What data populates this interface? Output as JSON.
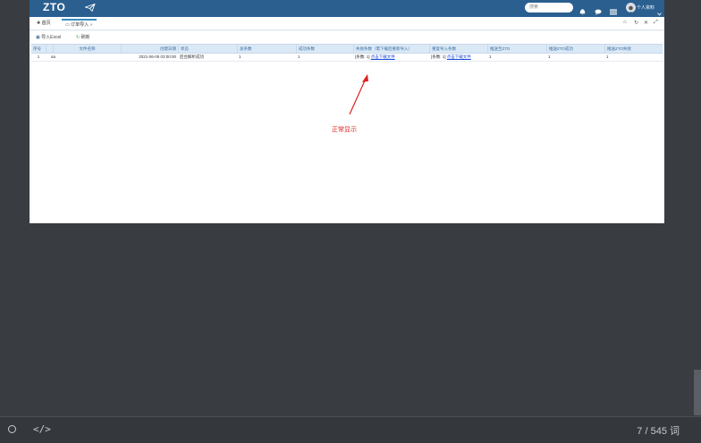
{
  "app": {
    "logo": "ZTO",
    "search_placeholder": "搜索",
    "user_label": "个人资料"
  },
  "tabs": [
    {
      "label": "首页"
    },
    {
      "label": "订单导入"
    }
  ],
  "toolbar": {
    "import_label": "导入Excel",
    "refresh_label": "刷新"
  },
  "grid": {
    "columns": [
      "序号",
      "",
      "文件名称",
      "创建日期",
      "状态",
      "总条数",
      "成功条数",
      "失败条数（需下载后重新导入）",
      "重复导入条数",
      "推送至ZTO",
      "推送ZTO成功",
      "推送ZTO失败"
    ],
    "rows": [
      {
        "index": "1",
        "name": "aa",
        "created": "2021-06-05 03:00:00",
        "status": "后台解析成功",
        "total": "1",
        "success": "1",
        "failed_prefix": "[条数: 1]",
        "failed_link": "点击下载文件",
        "dup_prefix": "[条数: 1]",
        "dup_link": "点击下载文件",
        "pushed": "1",
        "push_ok": "1",
        "push_fail": "1"
      }
    ]
  },
  "annotation": {
    "text": "正常显示",
    "color": "#e02020"
  },
  "footer": {
    "word_count": "7 / 545 词"
  },
  "colors": {
    "topbar": "#2a5f8f",
    "header_row": "#dbe9f6",
    "background": "#393d42"
  }
}
